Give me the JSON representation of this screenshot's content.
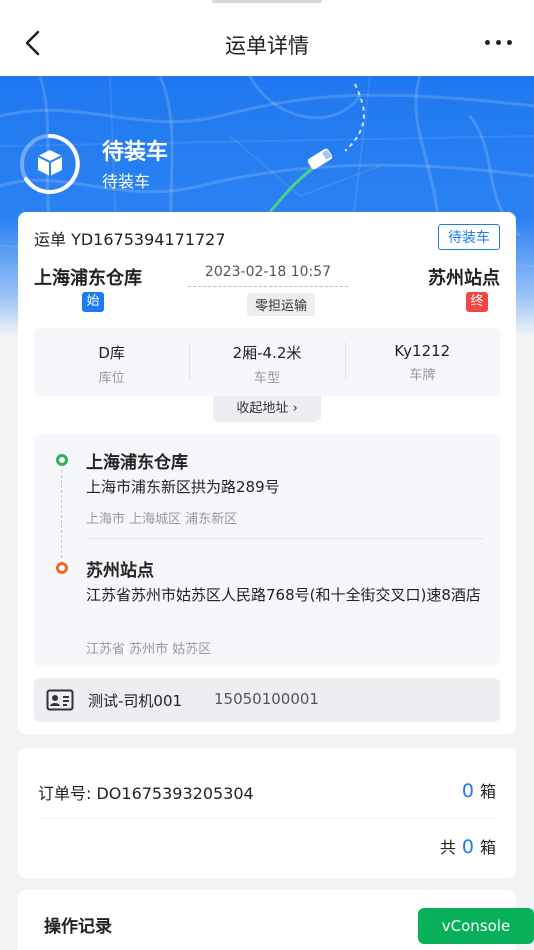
{
  "nav": {
    "title": "运单详情"
  },
  "status": {
    "title": "待装车",
    "subtitle": "待装车"
  },
  "waybill": {
    "label": "运单 YD1675394171727",
    "tag": "待装车",
    "from": "上海浦东仓库",
    "to": "苏州站点",
    "start_badge": "始",
    "end_badge": "终",
    "datetime": "2023-02-18 10:57",
    "mode": "零担运输"
  },
  "specs": [
    {
      "value": "D库",
      "key": "库位"
    },
    {
      "value": "2厢-4.2米",
      "key": "车型"
    },
    {
      "value": "Ky1212",
      "key": "车牌"
    }
  ],
  "collapse_label": "收起地址 ›",
  "addresses": {
    "origin": {
      "name": "上海浦东仓库",
      "line": "上海市浦东新区拱为路289号",
      "region": "上海市 上海城区 浦东新区"
    },
    "destination": {
      "name": "苏州站点",
      "line": "江苏省苏州市姑苏区人民路768号(和十全街交叉口)速8酒店",
      "region": "江苏省 苏州市 姑苏区"
    }
  },
  "driver": {
    "name": "测试-司机001",
    "phone": "15050100001"
  },
  "order": {
    "number_label": "订单号: DO1675393205304",
    "count": "0",
    "unit": "箱",
    "total_prefix": "共",
    "total": "0",
    "total_unit": "箱"
  },
  "log": {
    "title": "操作记录"
  },
  "vconsole": "vConsole",
  "colors": {
    "primary": "#1e7af0",
    "danger": "#f04646",
    "success": "#2db154",
    "origin_dot": "#2db154",
    "dest_dot": "#f06a2a"
  }
}
